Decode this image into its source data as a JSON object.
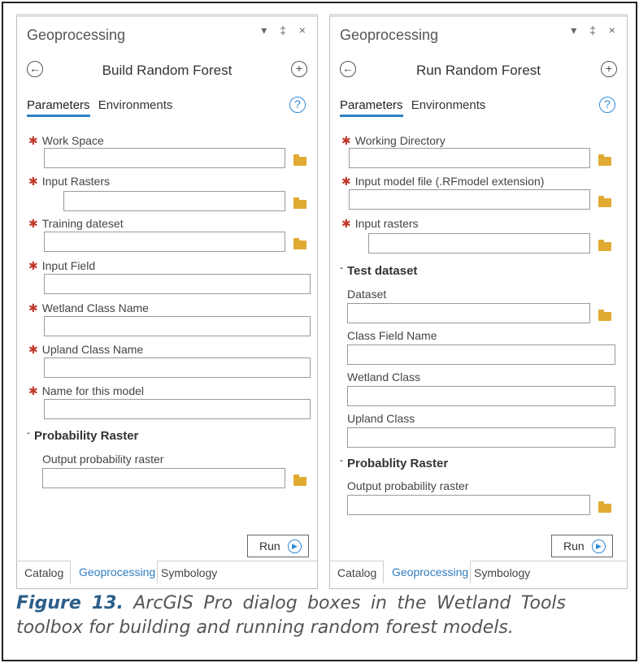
{
  "left_panel": {
    "title": "Geoprocessing",
    "window_controls": "▾ ‡ ×",
    "tool_name": "Build Random Forest",
    "tabs": [
      "Parameters",
      "Environments"
    ],
    "params": {
      "work_space": "Work Space",
      "input_rasters": "Input Rasters",
      "training_dataset": "Training dateset",
      "input_field": "Input Field",
      "wetland_class_name": "Wetland Class Name",
      "upland_class_name": "Upland Class Name",
      "model_name": "Name for this model"
    },
    "group_label": "Probability Raster",
    "output_label": "Output probability raster",
    "run_label": "Run",
    "bottom_tabs": [
      "Catalog",
      "Geoprocessing",
      "Symbology"
    ]
  },
  "right_panel": {
    "title": "Geoprocessing",
    "window_controls": "▾ ‡ ×",
    "tool_name": "Run Random Forest",
    "tabs": [
      "Parameters",
      "Environments"
    ],
    "params": {
      "working_directory": "Working Directory",
      "input_model_file": "Input model file (.RFmodel extension)",
      "input_rasters": "Input rasters"
    },
    "test_group_label": "Test dataset",
    "test_params": {
      "dataset": "Dataset",
      "class_field_name": "Class Field Name",
      "wetland_class": "Wetland Class",
      "upland_class": "Upland Class"
    },
    "group_label": "Probablity Raster",
    "output_label": "Output probability raster",
    "run_label": "Run",
    "bottom_tabs": [
      "Catalog",
      "Geoprocessing",
      "Symbology"
    ]
  },
  "caption": {
    "figure_label": "Figure 13.",
    "text": "ArcGIS Pro dialog boxes in the Wetland Tools toolbox for building and running random forest models."
  },
  "colors": {
    "accent": "#2f89d8",
    "required_star": "#c0392b",
    "folder": "#e0aa33",
    "caption_label": "#2b5f8a"
  },
  "icons": {
    "back": "back-arrow-icon",
    "add": "plus-icon",
    "help": "help-icon",
    "folder": "folder-icon",
    "run": "play-icon"
  }
}
